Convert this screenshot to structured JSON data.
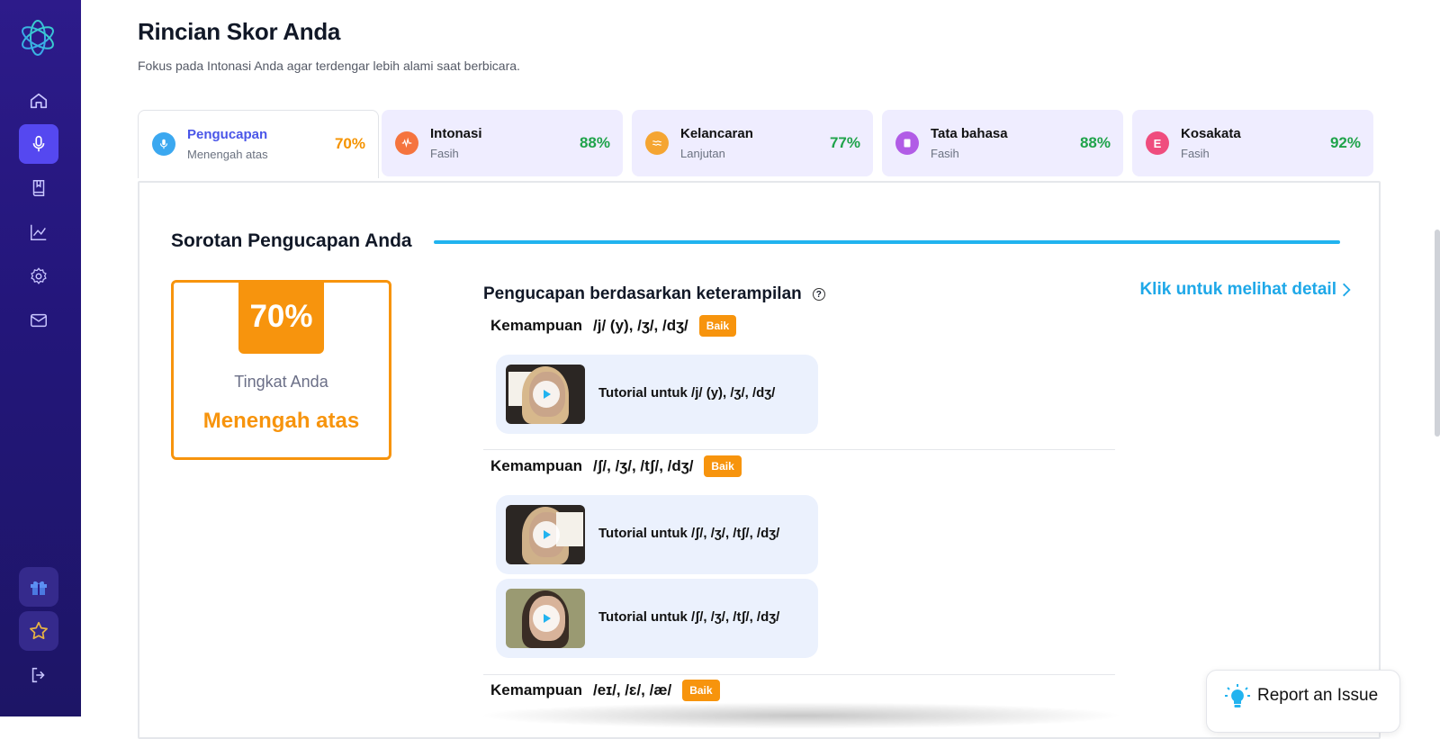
{
  "header": {
    "title": "Rincian Skor Anda",
    "subtitle": "Fokus pada Intonasi Anda agar terdengar lebih alami saat berbicara."
  },
  "sidebar": {
    "items": [
      {
        "icon": "home-icon"
      },
      {
        "icon": "microphone-icon",
        "active": true
      },
      {
        "icon": "book-icon"
      },
      {
        "icon": "chart-icon"
      },
      {
        "icon": "gear-icon"
      },
      {
        "icon": "mail-icon"
      }
    ],
    "bottom": [
      "gift-icon",
      "star-icon",
      "logout-icon"
    ]
  },
  "tabs": [
    {
      "name": "Pengucapan",
      "level": "Menengah atas",
      "score": "70%",
      "icon_color": "#3ba8f0",
      "active": true
    },
    {
      "name": "Intonasi",
      "level": "Fasih",
      "score": "88%",
      "icon_color": "#f5743e"
    },
    {
      "name": "Kelancaran",
      "level": "Lanjutan",
      "score": "77%",
      "icon_color": "#f5a532"
    },
    {
      "name": "Tata bahasa",
      "level": "Fasih",
      "score": "88%",
      "icon_color": "#b15ce6"
    },
    {
      "name": "Kosakata",
      "level": "Fasih",
      "score": "92%",
      "icon_color": "#ef4d7e",
      "icon_text": "E"
    }
  ],
  "highlight": {
    "title": "Sorotan Pengucapan Anda",
    "score": "70%",
    "caption": "Tingkat Anda",
    "level": "Menengah atas"
  },
  "skills": {
    "title": "Pengucapan berdasarkan keterampilan",
    "detail_link": "Klik untuk melihat detail",
    "groups": [
      {
        "prefix": "Kemampuan",
        "sounds": "/j/ (y), /ʒ/, /dʒ/",
        "badge": "Baik",
        "videos": [
          "Tutorial untuk /j/ (y), /ʒ/, /dʒ/"
        ]
      },
      {
        "prefix": "Kemampuan",
        "sounds": "/ʃ/, /ʒ/, /tʃ/, /dʒ/",
        "badge": "Baik",
        "videos": [
          "Tutorial untuk /ʃ/, /ʒ/, /tʃ/, /dʒ/",
          "Tutorial untuk /ʃ/, /ʒ/, /tʃ/, /dʒ/"
        ]
      },
      {
        "prefix": "Kemampuan",
        "sounds": "/eɪ/, /ɛ/, /æ/",
        "badge": "Baik",
        "videos": []
      }
    ]
  },
  "report": {
    "label": "Report an Issue"
  },
  "colors": {
    "accent_orange": "#f7940d",
    "accent_blue": "#20b3ef",
    "sidebar": "#2d1b8a",
    "score_green": "#1fa34a"
  }
}
